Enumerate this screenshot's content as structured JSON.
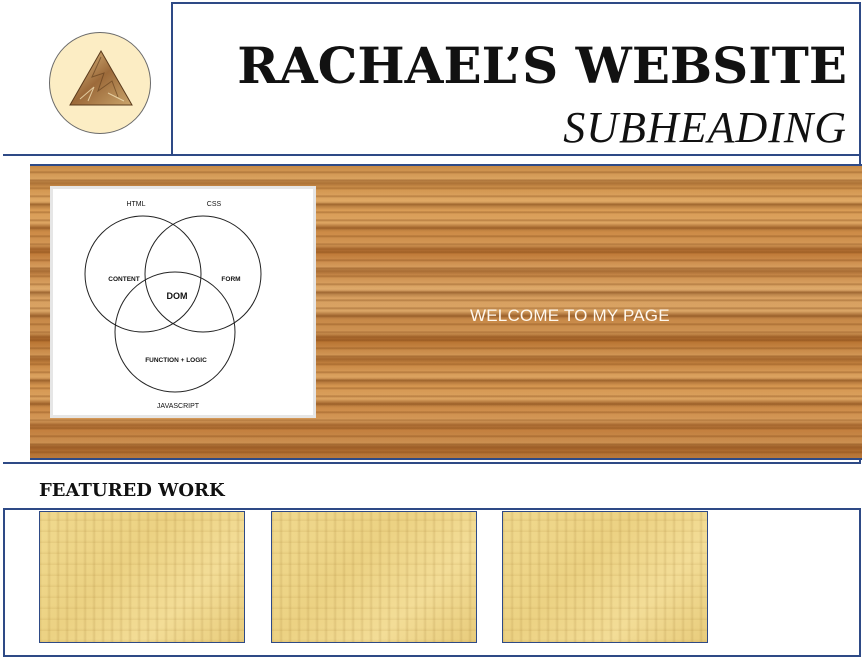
{
  "header": {
    "title": "RACHAEL’S WEBSITE",
    "subtitle": "SUBHEADING",
    "logo": {
      "icon": "triangle-rock-icon",
      "circle_color": "#fcedc4"
    }
  },
  "hero": {
    "welcome_text": "WELCOME TO MY PAGE",
    "venn": {
      "top_labels": [
        "HTML",
        "CSS"
      ],
      "bottom_label": "JAVASCRIPT",
      "regions": {
        "left": "CONTENT",
        "right": "FORM",
        "center": "DOM",
        "bottom": "FUNCTION + LOGIC"
      }
    }
  },
  "featured": {
    "title": "FEATURED WORK",
    "items": [
      {
        "name": "featured-item-1"
      },
      {
        "name": "featured-item-2"
      },
      {
        "name": "featured-item-3"
      }
    ]
  },
  "colors": {
    "border": "#2e4a86",
    "wood": "#c88a45",
    "papyrus": "#f0d98e"
  }
}
